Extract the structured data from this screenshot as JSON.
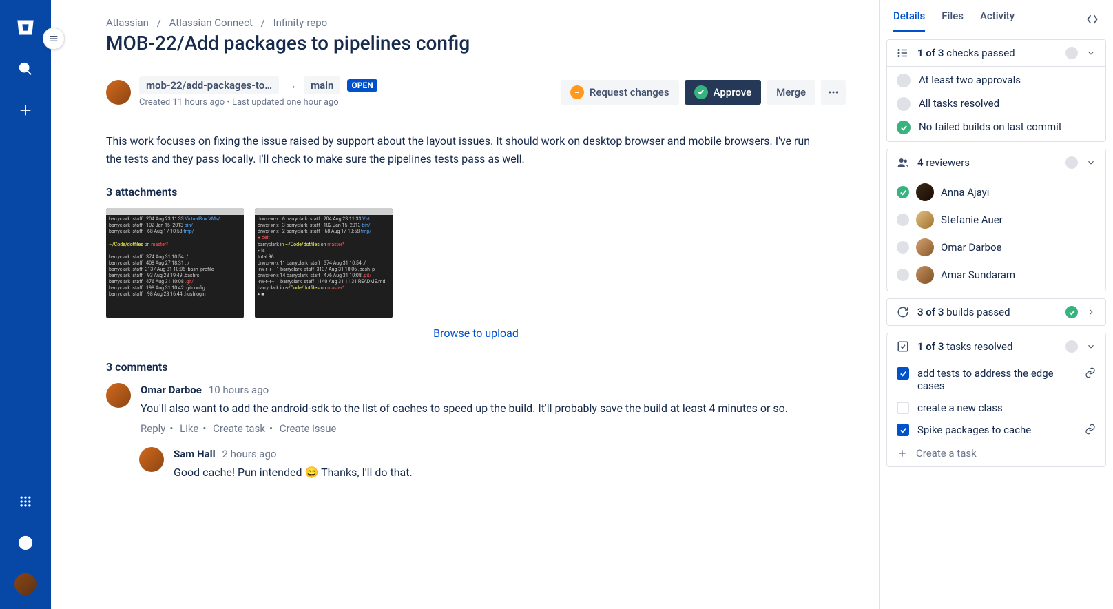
{
  "breadcrumbs": [
    "Atlassian",
    "Atlassian Connect",
    "Infinity-repo"
  ],
  "title": "MOB-22/Add packages to pipelines config",
  "pr": {
    "source_branch": "mob-22/add-packages-to…",
    "target_branch": "main",
    "status": "OPEN",
    "created": "Created 11 hours ago",
    "updated": "Last updated one hour ago"
  },
  "actions": {
    "request_changes": "Request changes",
    "approve": "Approve",
    "merge": "Merge"
  },
  "description": "This work focuses on fixing the issue raised by support about the layout issues. It should work on desktop browser and mobile browsers. I've run the tests and they pass locally. I'll check to make sure the pipelines tests pass as well.",
  "attachments_heading": "3 attachments",
  "browse_upload": "Browse to upload",
  "comments_heading": "3 comments",
  "comments": [
    {
      "author": "Omar Darboe",
      "time": "10 hours ago",
      "body": "You'll also want to add the android-sdk to the list of caches to speed up the build. It'll probably save the build at least 4 minutes or so.",
      "actions": [
        "Reply",
        "Like",
        "Create task",
        "Create issue"
      ]
    },
    {
      "author": "Sam Hall",
      "time": "2 hours ago",
      "body": "Good cache! Pun intended 😄 Thanks, I'll do that."
    }
  ],
  "right": {
    "tabs": [
      "Details",
      "Files",
      "Activity"
    ],
    "checks": {
      "summary_count": "1 of 3",
      "summary_label": "checks passed",
      "items": [
        {
          "label": "At least two approvals",
          "ok": false
        },
        {
          "label": "All tasks resolved",
          "ok": false
        },
        {
          "label": "No failed builds on last commit",
          "ok": true
        }
      ]
    },
    "reviewers": {
      "count": "4",
      "label": "reviewers",
      "items": [
        {
          "name": "Anna Ajayi",
          "approved": true
        },
        {
          "name": "Stefanie Auer",
          "approved": false
        },
        {
          "name": "Omar Darboe",
          "approved": false
        },
        {
          "name": "Amar Sundaram",
          "approved": false
        }
      ]
    },
    "builds": {
      "count": "3 of 3",
      "label": "builds passed"
    },
    "tasks": {
      "count": "1 of 3",
      "label": "tasks resolved",
      "items": [
        {
          "label": "add tests to address the edge cases",
          "checked": true,
          "link": true
        },
        {
          "label": "create a new class",
          "checked": false,
          "link": false
        },
        {
          "label": "Spike packages to cache",
          "checked": true,
          "link": true
        }
      ],
      "create": "Create a task"
    }
  }
}
